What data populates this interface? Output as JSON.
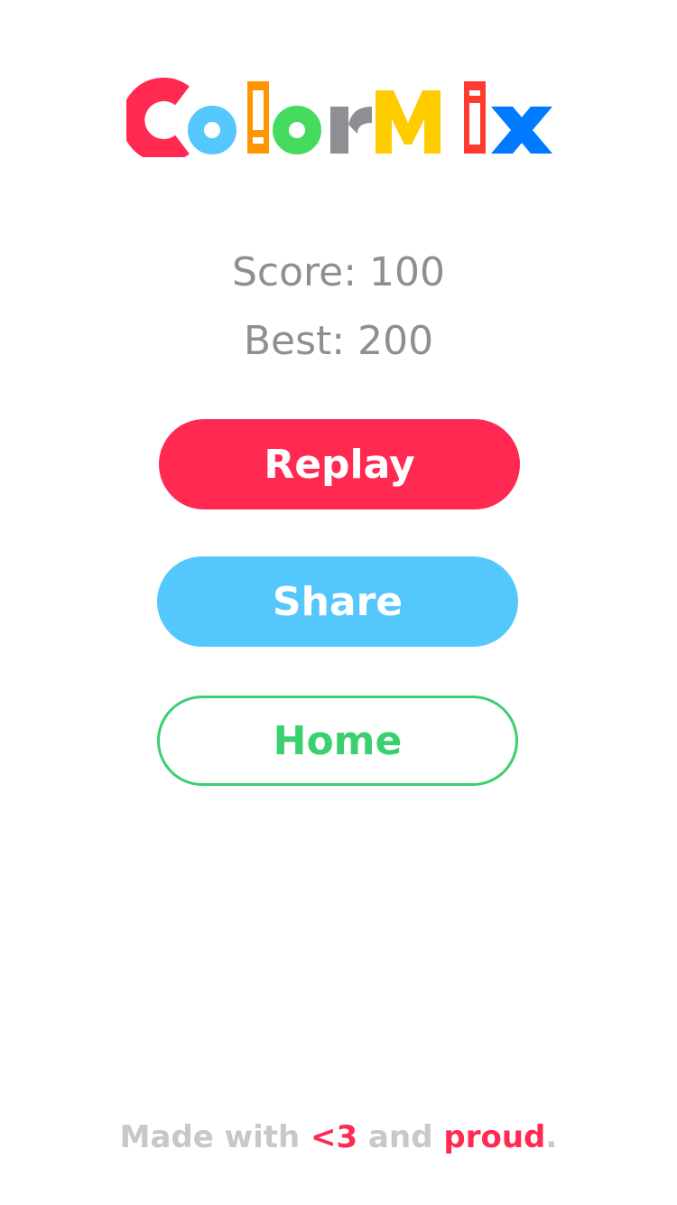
{
  "logo": {
    "text": "ColorMix",
    "letters": [
      {
        "char": "C",
        "color": "#ff2952"
      },
      {
        "char": "o",
        "color": "#54c7fc"
      },
      {
        "char": "l",
        "color": "#ff9500"
      },
      {
        "char": "o",
        "color": "#44db5e"
      },
      {
        "char": "r",
        "color": "#8e8e93"
      },
      {
        "char": "M",
        "color": "#ffcc00"
      },
      {
        "char": "i",
        "color": "#ff3b30"
      },
      {
        "char": "x",
        "color": "#007aff"
      }
    ]
  },
  "scores": {
    "score_label": "Score: 100",
    "best_label": "Best: 200"
  },
  "buttons": {
    "replay_label": "Replay",
    "share_label": "Share",
    "home_label": "Home"
  },
  "footer": {
    "part1": "Made with ",
    "heart": "<3",
    "part2": " and ",
    "proud": "proud",
    "period": "."
  },
  "colors": {
    "replay": "#ff2952",
    "share": "#54c7fc",
    "home": "#3bcf70",
    "score_text": "#8e8e93",
    "footer_text": "#c7c7cc",
    "footer_accent": "#ff2952"
  }
}
